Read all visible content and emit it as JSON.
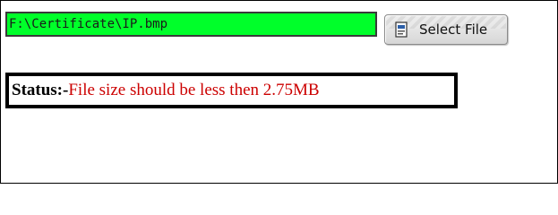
{
  "file_input": {
    "value": "F:\\Certificate\\IP.bmp"
  },
  "select_button": {
    "label": "Select File",
    "icon": "file-icon"
  },
  "status": {
    "prefix": "Status:-",
    "message": "File size should be less then 2.75MB"
  },
  "colors": {
    "field_bg": "#00ff2a",
    "status_message": "#cc0000",
    "status_border": "#000000"
  }
}
